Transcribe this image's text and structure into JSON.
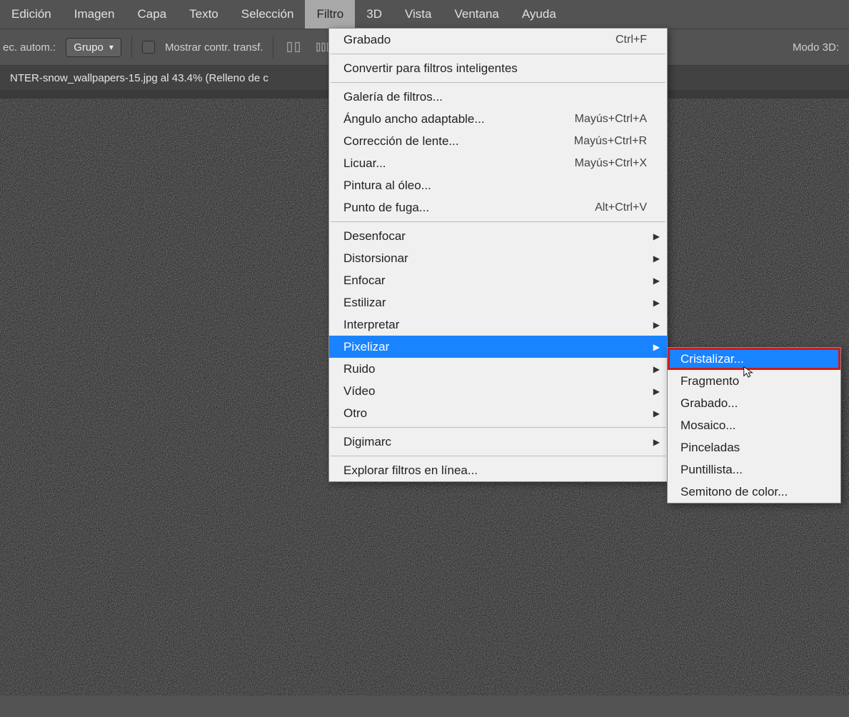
{
  "menubar": {
    "items": [
      {
        "label": "Edición"
      },
      {
        "label": "Imagen"
      },
      {
        "label": "Capa"
      },
      {
        "label": "Texto"
      },
      {
        "label": "Selección"
      },
      {
        "label": "Filtro",
        "active": true
      },
      {
        "label": "3D"
      },
      {
        "label": "Vista"
      },
      {
        "label": "Ventana"
      },
      {
        "label": "Ayuda"
      }
    ]
  },
  "options": {
    "autom_label": "ec. autom.:",
    "group_label": "Grupo",
    "show_controls_label": "Mostrar contr. transf.",
    "mode3d_label": "Modo 3D:"
  },
  "document_tab": {
    "title": "NTER-snow_wallpapers-15.jpg al 43.4% (Relleno de c"
  },
  "filter_menu": {
    "sections": [
      {
        "items": [
          {
            "label": "Grabado",
            "shortcut": "Ctrl+F"
          }
        ]
      },
      {
        "items": [
          {
            "label": "Convertir para filtros inteligentes"
          }
        ]
      },
      {
        "items": [
          {
            "label": "Galería de filtros..."
          },
          {
            "label": "Ángulo ancho adaptable...",
            "shortcut": "Mayús+Ctrl+A"
          },
          {
            "label": "Corrección de lente...",
            "shortcut": "Mayús+Ctrl+R"
          },
          {
            "label": "Licuar...",
            "shortcut": "Mayús+Ctrl+X"
          },
          {
            "label": "Pintura al óleo..."
          },
          {
            "label": "Punto de fuga...",
            "shortcut": "Alt+Ctrl+V"
          }
        ]
      },
      {
        "items": [
          {
            "label": "Desenfocar",
            "submenu": true
          },
          {
            "label": "Distorsionar",
            "submenu": true
          },
          {
            "label": "Enfocar",
            "submenu": true
          },
          {
            "label": "Estilizar",
            "submenu": true
          },
          {
            "label": "Interpretar",
            "submenu": true
          },
          {
            "label": "Pixelizar",
            "submenu": true,
            "highlighted": true
          },
          {
            "label": "Ruido",
            "submenu": true
          },
          {
            "label": "Vídeo",
            "submenu": true
          },
          {
            "label": "Otro",
            "submenu": true
          }
        ]
      },
      {
        "items": [
          {
            "label": "Digimarc",
            "submenu": true
          }
        ]
      },
      {
        "items": [
          {
            "label": "Explorar filtros en línea..."
          }
        ]
      }
    ]
  },
  "pixelizar_submenu": {
    "items": [
      {
        "label": "Cristalizar...",
        "highlighted": true
      },
      {
        "label": "Fragmento"
      },
      {
        "label": "Grabado..."
      },
      {
        "label": "Mosaico..."
      },
      {
        "label": "Pinceladas"
      },
      {
        "label": "Puntillista..."
      },
      {
        "label": "Semitono de color..."
      }
    ]
  }
}
